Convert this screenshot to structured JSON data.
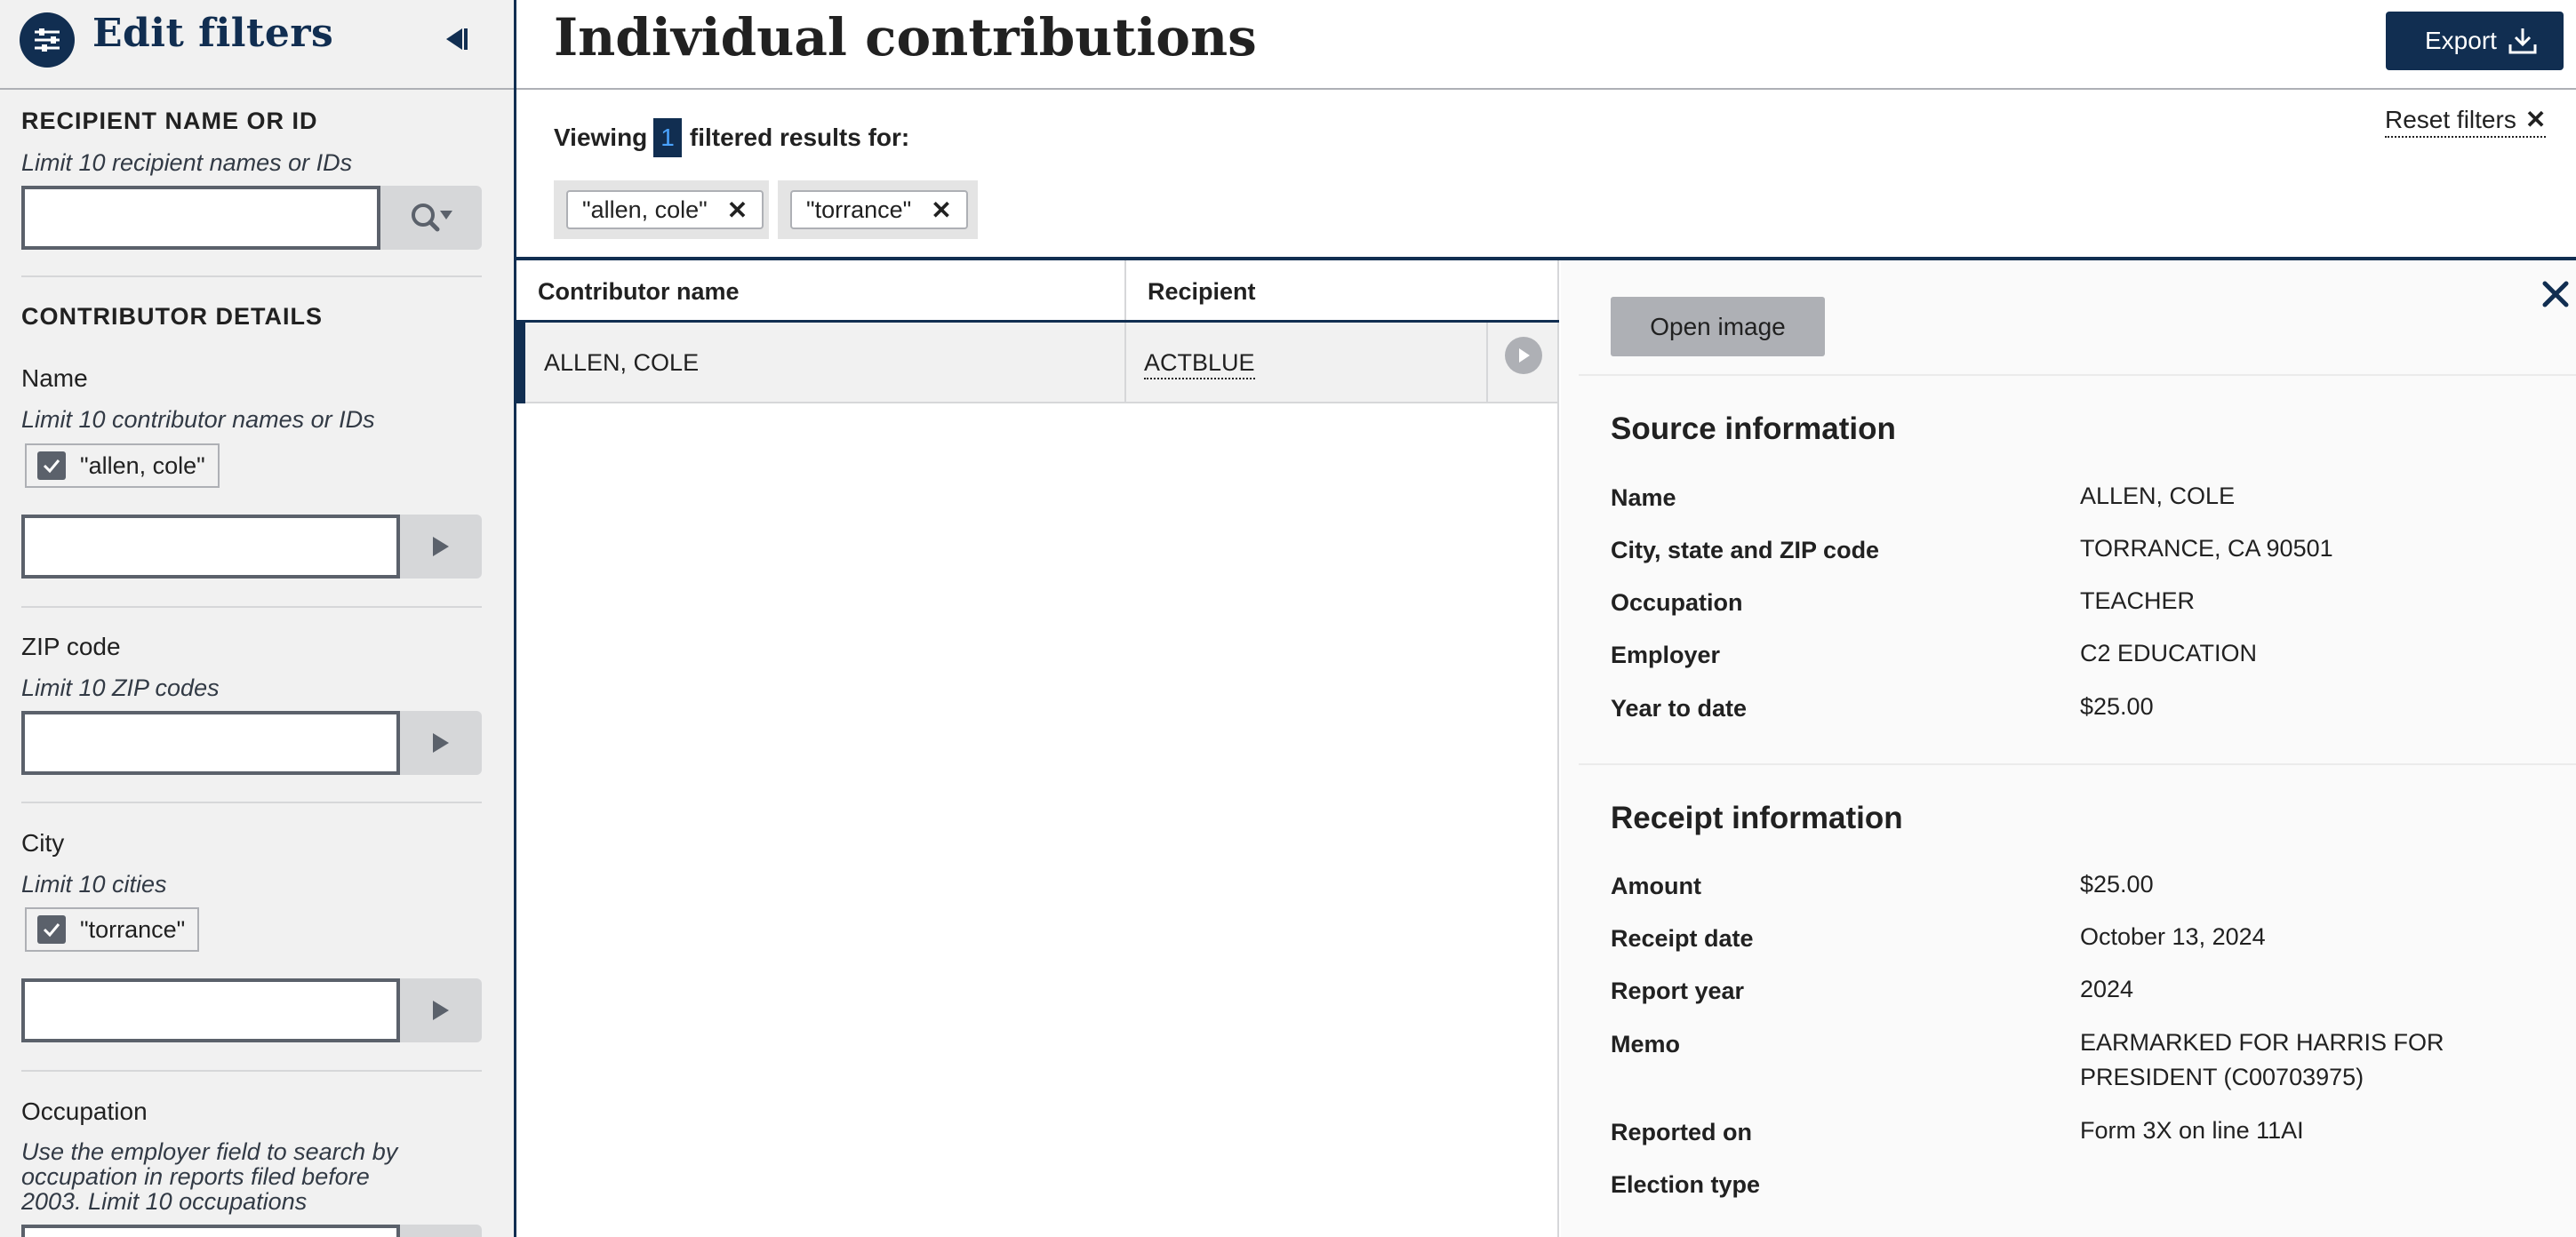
{
  "sidebar": {
    "title": "Edit filters",
    "recipient": {
      "section_title": "RECIPIENT NAME OR ID",
      "hint": "Limit 10 recipient names or IDs",
      "value": ""
    },
    "contributor": {
      "section_title": "CONTRIBUTOR DETAILS",
      "name": {
        "label": "Name",
        "hint": "Limit 10 contributor names or IDs",
        "checked_tag": "\"allen, cole\""
      },
      "zip": {
        "label": "ZIP code",
        "hint": "Limit 10 ZIP codes"
      },
      "city": {
        "label": "City",
        "hint": "Limit 10 cities",
        "checked_tag": "\"torrance\""
      },
      "occupation": {
        "label": "Occupation",
        "hint_lines": [
          "Use the employer field to search by",
          "occupation in reports filed before",
          "2003. Limit 10 occupations"
        ]
      }
    }
  },
  "header": {
    "title": "Individual contributions",
    "export_label": "Export"
  },
  "results": {
    "viewing_prefix": "Viewing",
    "count": "1",
    "viewing_suffix": "filtered results for:",
    "reset_label": "Reset filters",
    "active_filters": [
      "\"allen, cole\"",
      "\"torrance\""
    ]
  },
  "table": {
    "columns": [
      "Contributor name",
      "Recipient"
    ],
    "rows": [
      {
        "contributor_name": "ALLEN, COLE",
        "recipient": "ACTBLUE"
      }
    ]
  },
  "detail": {
    "open_image_label": "Open image",
    "source": {
      "heading": "Source information",
      "items": [
        {
          "key": "Name",
          "value": "ALLEN, COLE"
        },
        {
          "key": "City, state and ZIP code",
          "value": "TORRANCE, CA 90501"
        },
        {
          "key": "Occupation",
          "value": "TEACHER"
        },
        {
          "key": "Employer",
          "value": "C2 EDUCATION"
        },
        {
          "key": "Year to date",
          "value": "$25.00"
        }
      ]
    },
    "receipt": {
      "heading": "Receipt information",
      "items": [
        {
          "key": "Amount",
          "value": "$25.00"
        },
        {
          "key": "Receipt date",
          "value": "October 13, 2024"
        },
        {
          "key": "Report year",
          "value": "2024"
        },
        {
          "key": "Memo",
          "value": "EARMARKED FOR HARRIS FOR PRESIDENT (C00703975)"
        },
        {
          "key": "Reported on",
          "value": "Form 3X on line 11AI"
        },
        {
          "key": "Election type",
          "value": ""
        }
      ]
    }
  },
  "colors": {
    "navy": "#112e51",
    "badge_text": "#4aa3ff",
    "sidebar_bg": "#f1f1f1",
    "button_gray": "#aeb0b5"
  },
  "icons": [
    "filter-sliders-icon",
    "collapse-left-icon",
    "search-dropdown-icon",
    "play-arrow-icon",
    "check-icon",
    "download-icon",
    "close-icon",
    "play-circle-icon"
  ]
}
